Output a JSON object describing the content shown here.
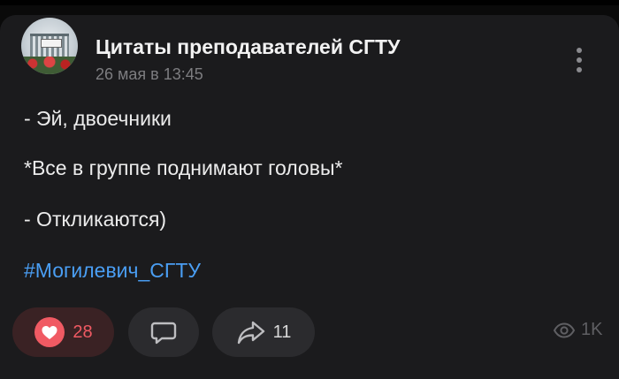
{
  "post": {
    "group_name": "Цитаты преподавателей СГТУ",
    "date": "26 мая в 13:45",
    "lines": [
      "- Эй, двоечники",
      "*Все в группе поднимают головы*",
      "- Откликаются)"
    ],
    "hashtag": "#Могилевич_СГТУ"
  },
  "actions": {
    "likes": "28",
    "shares": "11",
    "views": "1K"
  },
  "icons": {
    "like": "heart-icon",
    "comment": "comment-icon",
    "share": "share-icon",
    "views": "eye-icon",
    "more": "more-vertical-icon"
  },
  "colors": {
    "background": "#1b1b1d",
    "like_accent": "#f05a63",
    "hashtag": "#4a9ef3",
    "muted": "#7d7d80"
  }
}
